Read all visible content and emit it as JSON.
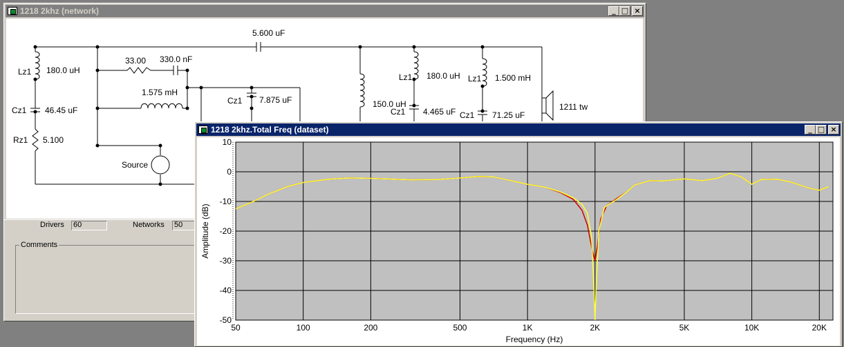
{
  "network_window": {
    "title": "1218 2khz (network)",
    "buttons": {
      "minimize": "_",
      "maximize": "□",
      "close": "×"
    },
    "components": {
      "c_top": "5.600 uF",
      "l_left": "Lz1",
      "l_left_val": "180.0 uH",
      "c_left": "Cz1",
      "c_left_val": "46.45 uF",
      "r_left": "Rz1",
      "r_left_val": "5.100",
      "r_series": "33.00",
      "c_series": "330.0 nF",
      "l_mid": "1.575 mH",
      "c_mid": "Cz1",
      "c_mid_val": "7.875 uF",
      "source": "Source",
      "l_shunt_val": "150.0 uH",
      "l_r1": "Lz1",
      "l_r1_val": "180.0 uH",
      "c_r1": "Cz1",
      "c_r1_val": "4.465 uF",
      "l_r2": "Lz1",
      "l_r2_val": "1.500 mH",
      "c_r2": "Cz1",
      "c_r2_val": "71.25 uF",
      "driver": "1211 tw"
    }
  },
  "info_panel": {
    "drivers_label": "Drivers",
    "drivers_value": "60",
    "networks_label": "Networks",
    "networks_value": "50",
    "comments_label": "Comments"
  },
  "freq_window": {
    "title": "1218 2khz.Total Freq (dataset)",
    "buttons": {
      "minimize": "_",
      "maximize": "□",
      "close": "×"
    }
  },
  "chart_data": {
    "type": "line",
    "xlabel": "Frequency (Hz)",
    "ylabel": "Amplitude (dB)",
    "x_scale": "log",
    "xlim": [
      50,
      23000
    ],
    "ylim": [
      -50,
      10
    ],
    "grid": true,
    "x_ticks": [
      {
        "value": 50,
        "label": "50"
      },
      {
        "value": 100,
        "label": "100"
      },
      {
        "value": 200,
        "label": "200"
      },
      {
        "value": 500,
        "label": "500"
      },
      {
        "value": 1000,
        "label": "1K"
      },
      {
        "value": 2000,
        "label": "2K"
      },
      {
        "value": 5000,
        "label": "5K"
      },
      {
        "value": 10000,
        "label": "10K"
      },
      {
        "value": 20000,
        "label": "20K"
      }
    ],
    "y_ticks": [
      {
        "value": 10,
        "label": "10"
      },
      {
        "value": 0,
        "label": "0"
      },
      {
        "value": -10,
        "label": "-10"
      },
      {
        "value": -20,
        "label": "-20"
      },
      {
        "value": -30,
        "label": "-30"
      },
      {
        "value": -40,
        "label": "-40"
      },
      {
        "value": -50,
        "label": "-50"
      }
    ],
    "colors": {
      "plot_bg": "#c0c0c0",
      "grid": "#000000",
      "series_red": "#cc0000",
      "series_yellow": "#ffff33"
    },
    "series": [
      {
        "color": "#cc0000",
        "points": [
          [
            50,
            -12.5
          ],
          [
            60,
            -10
          ],
          [
            70,
            -7.5
          ],
          [
            85,
            -5
          ],
          [
            100,
            -3.6
          ],
          [
            130,
            -2.5
          ],
          [
            160,
            -2.1
          ],
          [
            200,
            -2.2
          ],
          [
            300,
            -2.7
          ],
          [
            400,
            -2.6
          ],
          [
            500,
            -2.1
          ],
          [
            600,
            -1.6
          ],
          [
            700,
            -1.7
          ],
          [
            800,
            -2.6
          ],
          [
            1000,
            -4.2
          ],
          [
            1200,
            -5.2
          ],
          [
            1400,
            -7
          ],
          [
            1600,
            -9.3
          ],
          [
            1750,
            -13
          ],
          [
            1850,
            -18
          ],
          [
            1950,
            -27
          ],
          [
            2000,
            -30
          ],
          [
            2050,
            -25
          ],
          [
            2120,
            -16
          ],
          [
            2250,
            -11.5
          ],
          [
            2500,
            -9
          ],
          [
            2800,
            -6.5
          ],
          [
            3000,
            -4.5
          ],
          [
            3500,
            -3
          ],
          [
            4000,
            -3.1
          ],
          [
            5000,
            -2.4
          ],
          [
            6000,
            -3
          ],
          [
            7000,
            -2.2
          ],
          [
            8000,
            -0.5
          ],
          [
            9000,
            -1.8
          ],
          [
            10000,
            -4.2
          ],
          [
            11000,
            -2.6
          ],
          [
            13000,
            -2.5
          ],
          [
            15000,
            -3.5
          ],
          [
            18000,
            -5.5
          ],
          [
            20000,
            -6.2
          ],
          [
            22000,
            -5
          ]
        ]
      },
      {
        "color": "#ffff33",
        "points": [
          [
            50,
            -12.5
          ],
          [
            60,
            -10
          ],
          [
            70,
            -7.5
          ],
          [
            85,
            -5
          ],
          [
            100,
            -3.6
          ],
          [
            130,
            -2.5
          ],
          [
            160,
            -2.1
          ],
          [
            200,
            -2.2
          ],
          [
            300,
            -2.7
          ],
          [
            400,
            -2.6
          ],
          [
            500,
            -2.1
          ],
          [
            600,
            -1.6
          ],
          [
            700,
            -1.7
          ],
          [
            800,
            -2.6
          ],
          [
            1000,
            -4.2
          ],
          [
            1200,
            -5.2
          ],
          [
            1400,
            -6.8
          ],
          [
            1600,
            -8.8
          ],
          [
            1750,
            -11
          ],
          [
            1850,
            -14
          ],
          [
            1930,
            -22
          ],
          [
            1980,
            -40
          ],
          [
            2000,
            -50
          ],
          [
            2020,
            -40
          ],
          [
            2080,
            -20
          ],
          [
            2200,
            -12
          ],
          [
            2500,
            -9.3
          ],
          [
            2800,
            -6.5
          ],
          [
            3000,
            -4.5
          ],
          [
            3500,
            -3
          ],
          [
            4000,
            -3.1
          ],
          [
            5000,
            -2.4
          ],
          [
            6000,
            -3
          ],
          [
            7000,
            -2.2
          ],
          [
            8000,
            -0.5
          ],
          [
            9000,
            -1.8
          ],
          [
            10000,
            -4.2
          ],
          [
            11000,
            -2.6
          ],
          [
            13000,
            -2.5
          ],
          [
            15000,
            -3.5
          ],
          [
            18000,
            -5.5
          ],
          [
            20000,
            -6.2
          ],
          [
            22000,
            -5
          ]
        ]
      }
    ]
  }
}
